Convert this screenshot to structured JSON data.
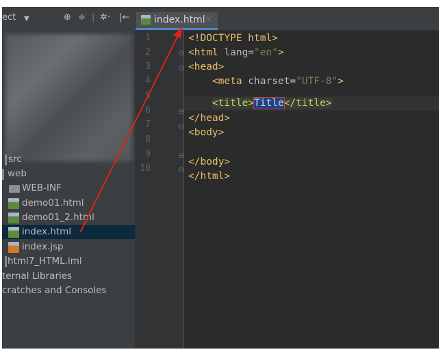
{
  "project_panel": {
    "title": "ect",
    "icons": {
      "dropdown": "▼",
      "sync": "⊕",
      "collapse": "≑",
      "divider": "|",
      "gear": "✲·",
      "hide": "|←"
    },
    "tree": [
      {
        "label": "src",
        "icon": "bar-icon"
      },
      {
        "label": "web",
        "icon": "bar-icon"
      },
      {
        "label": "WEB-INF",
        "icon": "folder-icon"
      },
      {
        "label": "demo01.html",
        "icon": "html-file-icon"
      },
      {
        "label": "demo01_2.html",
        "icon": "html-file-icon"
      },
      {
        "label": "index.html",
        "icon": "html-file-icon",
        "selected": true
      },
      {
        "label": "index.jsp",
        "icon": "jsp-file-icon"
      },
      {
        "label": "html7_HTML.iml",
        "icon": "iml-file-icon"
      },
      {
        "label": "ternal Libraries",
        "icon": ""
      },
      {
        "label": "cratches and Consoles",
        "icon": ""
      }
    ]
  },
  "editor": {
    "tab": {
      "label": "index.html",
      "close": "×"
    },
    "line_numbers": [
      "1",
      "2",
      "3",
      "4",
      "5",
      "6",
      "7",
      "8",
      "9",
      "10"
    ],
    "code": {
      "l1_tag": "<!DOCTYPE html>",
      "l2_open": "<html ",
      "l2_attr": "lang=",
      "l2_val": "\"en\"",
      "l2_close": ">",
      "l3_tag": "<head>",
      "l4_indent": "    ",
      "l4_open": "<meta ",
      "l4_attr": "charset=",
      "l4_val": "\"UTF-8\"",
      "l4_close": ">",
      "l5_indent": "    ",
      "l5_open": "<title>",
      "l5_text": "Title",
      "l5_close": "</title>",
      "l6_tag": "</head>",
      "l7_tag": "<body>",
      "l9_tag": "</body>",
      "l10_tag": "</html>"
    }
  },
  "annotation": {
    "color": "#e02020"
  },
  "colors": {
    "editor_bg": "#2b2b2b",
    "panel_bg": "#3c3f41",
    "tag": "#e8bf6a",
    "string": "#6a8759",
    "selected_row": "#0d293e",
    "tab_underline": "#4a88c7"
  }
}
